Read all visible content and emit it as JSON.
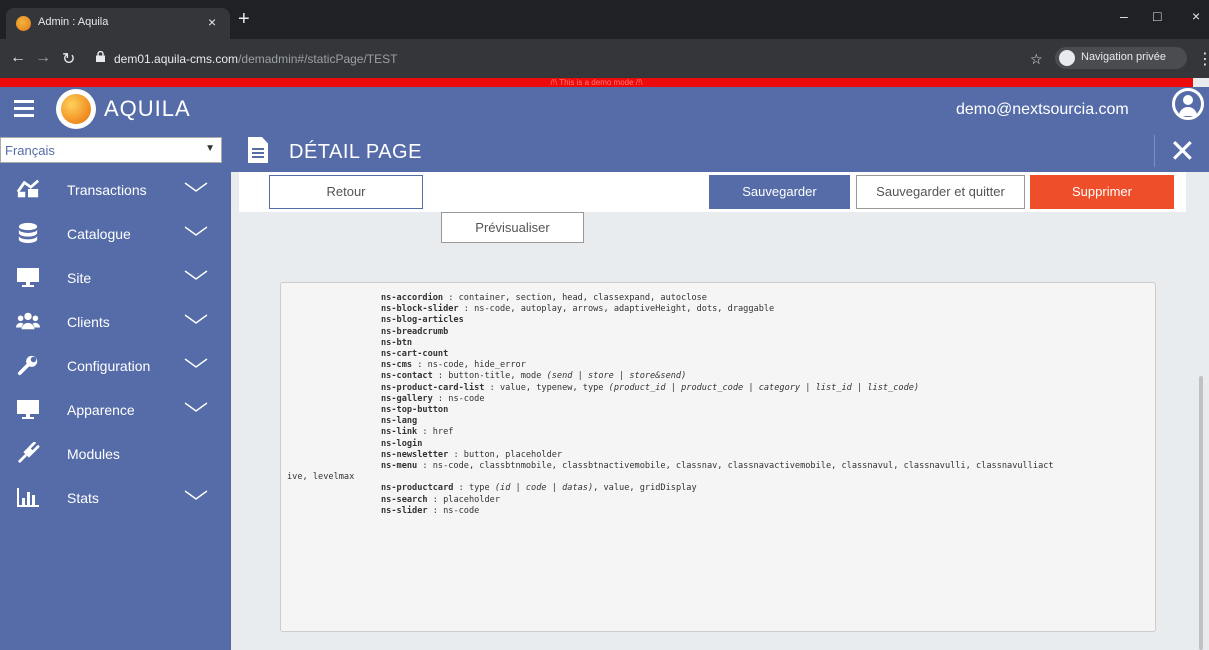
{
  "browser": {
    "tab_title": "Admin : Aquila",
    "tab_close": "×",
    "new_tab": "+",
    "url_host": "dem01.aquila-cms.com",
    "url_path": "/demadmin#/staticPage/TEST",
    "incognito_label": "Navigation privée",
    "window_controls": [
      "–",
      "□",
      "×"
    ]
  },
  "demo_banner": "/!\\ This is a demo mode /!\\",
  "header": {
    "logo_text": "AQUILA",
    "user_email": "demo@nextsourcia.com"
  },
  "sidebar": {
    "language": "Français",
    "items": [
      {
        "label": "Transactions",
        "icon": "transactions-icon",
        "has_chevron": true
      },
      {
        "label": "Catalogue",
        "icon": "database-icon",
        "has_chevron": true
      },
      {
        "label": "Site",
        "icon": "monitor-icon",
        "has_chevron": true
      },
      {
        "label": "Clients",
        "icon": "users-icon",
        "has_chevron": true
      },
      {
        "label": "Configuration",
        "icon": "wrench-icon",
        "has_chevron": true
      },
      {
        "label": "Apparence",
        "icon": "monitor-icon",
        "has_chevron": true
      },
      {
        "label": "Modules",
        "icon": "plug-icon",
        "has_chevron": false
      },
      {
        "label": "Stats",
        "icon": "bar-chart-icon",
        "has_chevron": true
      }
    ]
  },
  "page": {
    "title": "DÉTAIL PAGE",
    "close": "✕"
  },
  "toolbar": {
    "back": "Retour",
    "save": "Sauvegarder",
    "save_quit": "Sauvegarder et quitter",
    "delete": "Supprimer",
    "preview": "Prévisualiser"
  },
  "components": [
    {
      "name": "ns-accordion",
      "rest": " : container, section, head, classexpand, autoclose"
    },
    {
      "name": "ns-block-slider",
      "rest": " : ns-code, autoplay, arrows, adaptiveHeight, dots, draggable"
    },
    {
      "name": "ns-blog-articles",
      "rest": ""
    },
    {
      "name": "ns-breadcrumb",
      "rest": ""
    },
    {
      "name": "ns-btn",
      "rest": ""
    },
    {
      "name": "ns-cart-count",
      "rest": ""
    },
    {
      "name": "ns-cms",
      "rest": " : ns-code, hide_error"
    },
    {
      "name": "ns-contact",
      "rest": " : button-title, mode ",
      "italic": "(send | store | store&send)"
    },
    {
      "name": "ns-product-card-list",
      "rest": " : value, typenew, type ",
      "italic": "(product_id | product_code | category | list_id | list_code)"
    },
    {
      "name": "ns-gallery",
      "rest": " : ns-code"
    },
    {
      "name": "ns-top-button",
      "rest": ""
    },
    {
      "name": "ns-lang",
      "rest": ""
    },
    {
      "name": "ns-link",
      "rest": " : href"
    },
    {
      "name": "ns-login",
      "rest": ""
    },
    {
      "name": "ns-newsletter",
      "rest": " : button, placeholder"
    },
    {
      "name": "ns-menu",
      "rest": " : ns-code, classbtnmobile, classbtnactivemobile, classnav, classnavactivemobile, classnavul, classnavulli, classnavulliact"
    },
    {
      "name": "",
      "rest": "ive, levelmax",
      "wrap": true
    },
    {
      "name": "ns-productcard",
      "rest": " : type ",
      "italic": "(id | code | datas)",
      "after": ", value, gridDisplay"
    },
    {
      "name": "ns-search",
      "rest": " : placeholder"
    },
    {
      "name": "ns-slider",
      "rest": " : ns-code"
    }
  ]
}
